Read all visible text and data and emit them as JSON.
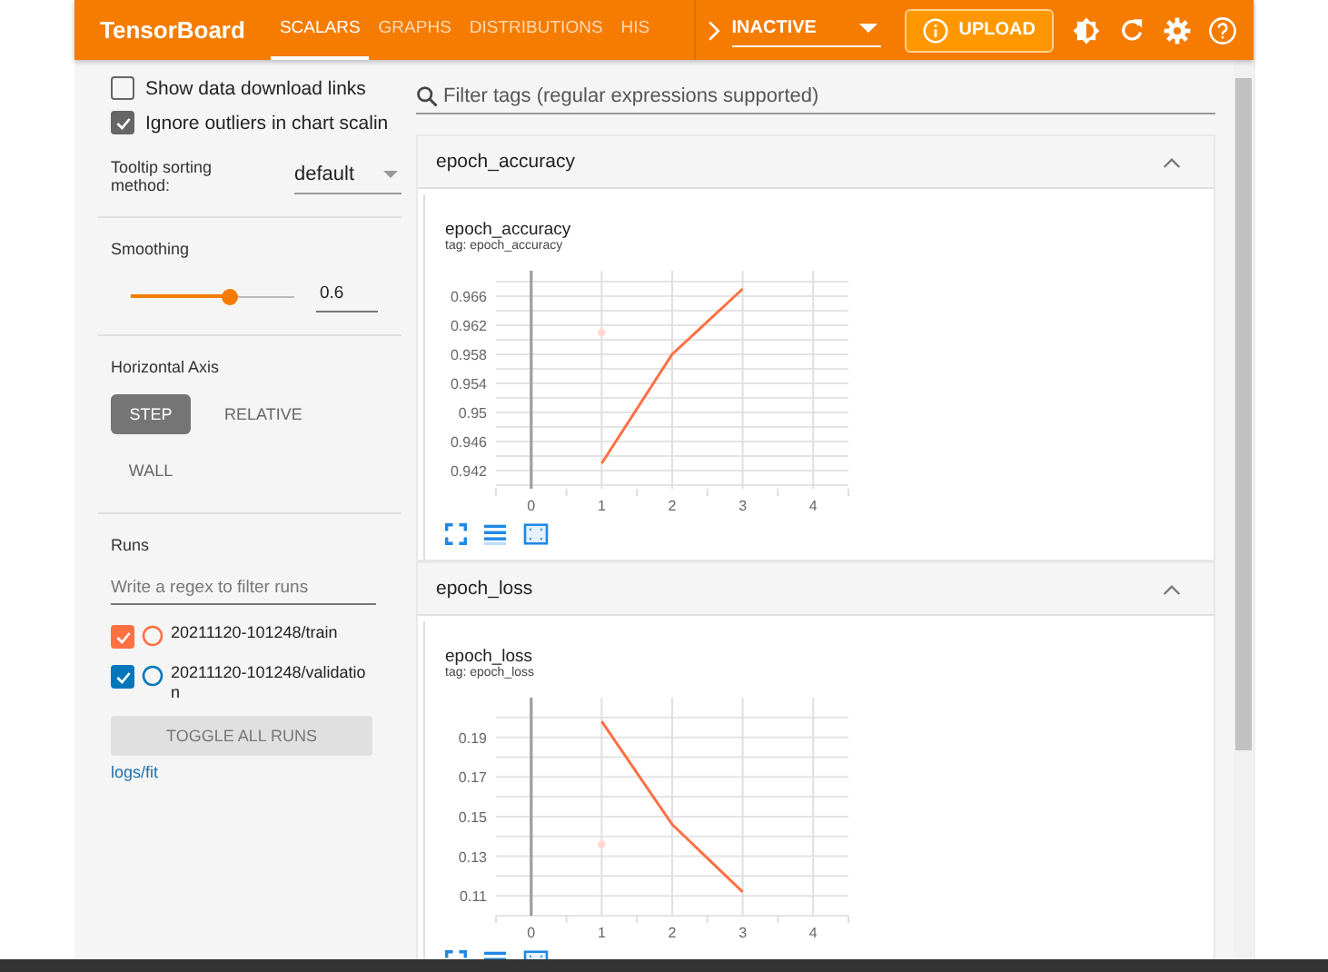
{
  "header": {
    "title": "TensorBoard",
    "tabs": [
      {
        "label": "SCALARS",
        "selected": true
      },
      {
        "label": "GRAPHS",
        "selected": false
      },
      {
        "label": "DISTRIBUTIONS",
        "selected": false
      },
      {
        "label": "HIS",
        "selected": false
      }
    ],
    "run_status": "INACTIVE",
    "upload_button": "UPLOAD"
  },
  "sidebar": {
    "checkboxes": [
      {
        "label": "Show data download links",
        "checked": false
      },
      {
        "label": "Ignore outliers in chart scalin",
        "checked": true
      }
    ],
    "tooltip_sorting": {
      "label": "Tooltip sorting method:",
      "value": "default"
    },
    "smoothing": {
      "label": "Smoothing",
      "level": 0.6,
      "value": "0.6"
    },
    "horizontal_axis": {
      "label": "Horizontal Axis",
      "options": [
        {
          "label": "STEP",
          "selected": true
        },
        {
          "label": "RELATIVE",
          "selected": false
        },
        {
          "label": "WALL",
          "selected": false
        }
      ]
    },
    "runs": {
      "label": "Runs",
      "filter_placeholder": "Write a regex to filter runs",
      "items": [
        {
          "name": "20211120-101248/train",
          "checked": true,
          "color": "#ff7043"
        },
        {
          "name": "20211120-101248/validation",
          "checked": true,
          "color": "#0077bb"
        }
      ],
      "toggle_button": "TOGGLE ALL RUNS",
      "log_dir": "logs/fit"
    }
  },
  "main": {
    "filter_placeholder": "Filter tags (regular expressions supported)",
    "cards": [
      {
        "heading": "epoch_accuracy",
        "expanded": true,
        "chart_title": "epoch_accuracy",
        "tag": "tag: epoch_accuracy",
        "chart_data": {
          "type": "line",
          "x": [
            1,
            2,
            3
          ],
          "xlim": [
            -0.5,
            4.5
          ],
          "ylim": [
            0.9395,
            0.9695
          ],
          "xticks": [
            0,
            1,
            2,
            3,
            4
          ],
          "yticks": [
            0.942,
            0.946,
            {
              "value": 0.95,
              "label": "0.95"
            },
            0.954,
            0.958,
            0.962,
            0.966
          ],
          "grid": true,
          "series": [
            {
              "color": "#ffd6cc",
              "marker": true,
              "values": [
                0.961,
                null,
                null
              ]
            },
            {
              "color": "#ff7043",
              "values": [
                0.943,
                0.958,
                0.967
              ]
            }
          ]
        }
      },
      {
        "heading": "epoch_loss",
        "expanded": true,
        "chart_title": "epoch_loss",
        "tag": "tag: epoch_loss",
        "chart_data": {
          "type": "line",
          "x": [
            1,
            2,
            3
          ],
          "xlim": [
            -0.5,
            4.5
          ],
          "ylim": [
            0.1,
            0.21
          ],
          "xticks": [
            0,
            1,
            2,
            3,
            4
          ],
          "yticks": [
            0.11,
            0.13,
            0.15,
            0.17,
            0.19
          ],
          "grid": true,
          "series": [
            {
              "color": "#ffd6cc",
              "marker": true,
              "values": [
                0.136,
                null,
                null
              ]
            },
            {
              "color": "#ff7043",
              "values": [
                0.198,
                0.146,
                0.112
              ]
            }
          ]
        }
      }
    ]
  }
}
